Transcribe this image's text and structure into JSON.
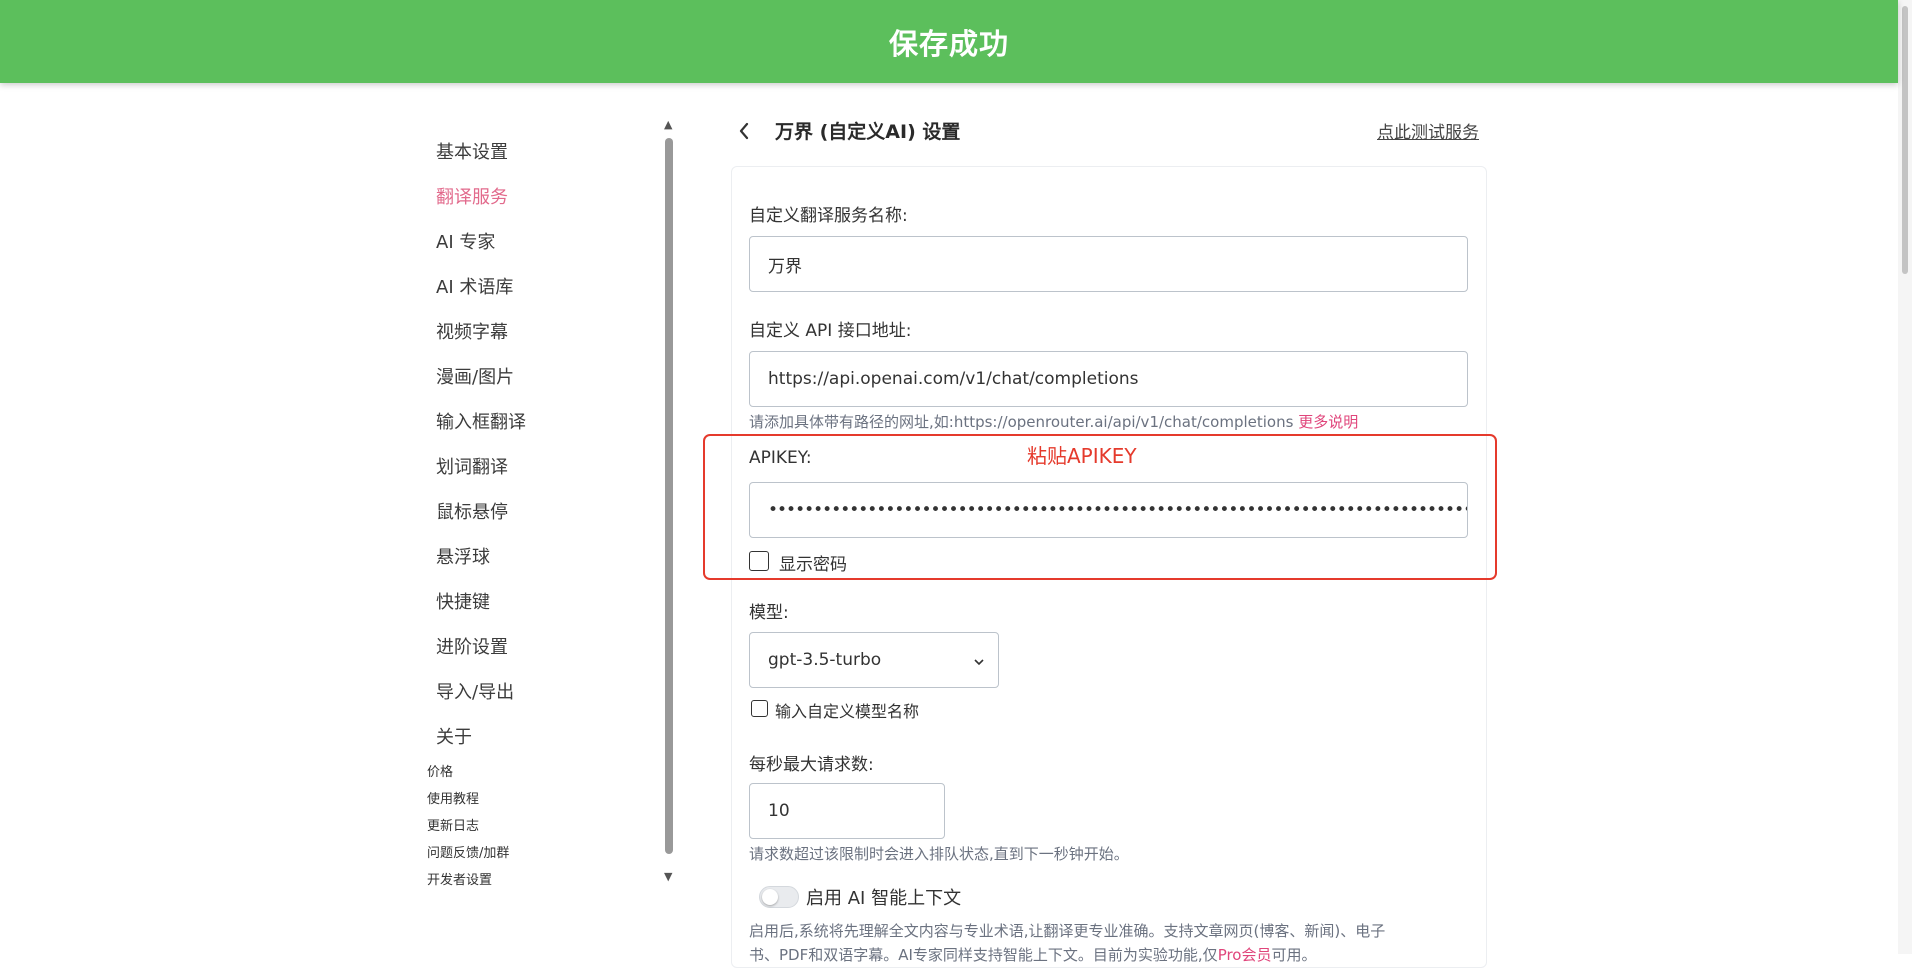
{
  "toast": {
    "message": "保存成功"
  },
  "sidebar": {
    "items": [
      {
        "label": "基本设置",
        "active": false
      },
      {
        "label": "翻译服务",
        "active": true
      },
      {
        "label": "AI 专家",
        "active": false
      },
      {
        "label": "AI 术语库",
        "active": false
      },
      {
        "label": "视频字幕",
        "active": false
      },
      {
        "label": "漫画/图片",
        "active": false
      },
      {
        "label": "输入框翻译",
        "active": false
      },
      {
        "label": "划词翻译",
        "active": false
      },
      {
        "label": "鼠标悬停",
        "active": false
      },
      {
        "label": "悬浮球",
        "active": false
      },
      {
        "label": "快捷键",
        "active": false
      },
      {
        "label": "进阶设置",
        "active": false
      },
      {
        "label": "导入/导出",
        "active": false
      },
      {
        "label": "关于",
        "active": false
      }
    ],
    "sub_links": [
      "价格",
      "使用教程",
      "更新日志",
      "问题反馈/加群",
      "开发者设置"
    ],
    "active_color": "#e26a8c"
  },
  "header": {
    "title": "万界 (自定义AI) 设置",
    "test_link": "点此测试服务"
  },
  "form": {
    "service_name": {
      "label": "自定义翻译服务名称:",
      "value": "万界"
    },
    "api_url": {
      "label": "自定义 API 接口地址:",
      "value": "https://api.openai.com/v1/chat/completions",
      "hint": "请添加具体带有路径的网址,如:https://openrouter.ai/api/v1/chat/completions",
      "hint_link": "更多说明"
    },
    "apikey": {
      "label": "APIKEY:",
      "value": "••••••••••••••••••••••••••••••••••••••••••••••••••••••••••••••••••••••••••••••••••••••••••",
      "show_password_label": "显示密码",
      "annotation": "粘贴APIKEY"
    },
    "model": {
      "label": "模型:",
      "selected": "gpt-3.5-turbo",
      "custom_model_label": "输入自定义模型名称"
    },
    "max_requests": {
      "label": "每秒最大请求数:",
      "value": "10",
      "hint": "请求数超过该限制时会进入排队状态,直到下一秒钟开始。"
    },
    "ai_context": {
      "label": "启用 AI 智能上下文",
      "enabled": false,
      "description_line1": "启用后,系统将先理解全文内容与专业术语,让翻译更专业准确。支持文章网页(博客、新闻)、电子",
      "description_line2": "书、PDF和双语字幕。AI专家同样支持智能上下文。目前为实验功能,仅",
      "description_pro": "Pro会员",
      "description_tail": "可用。"
    }
  },
  "colors": {
    "toast_bg": "#5cbf5c",
    "highlight": "#e53a2c",
    "link_pink": "#e0457b"
  }
}
